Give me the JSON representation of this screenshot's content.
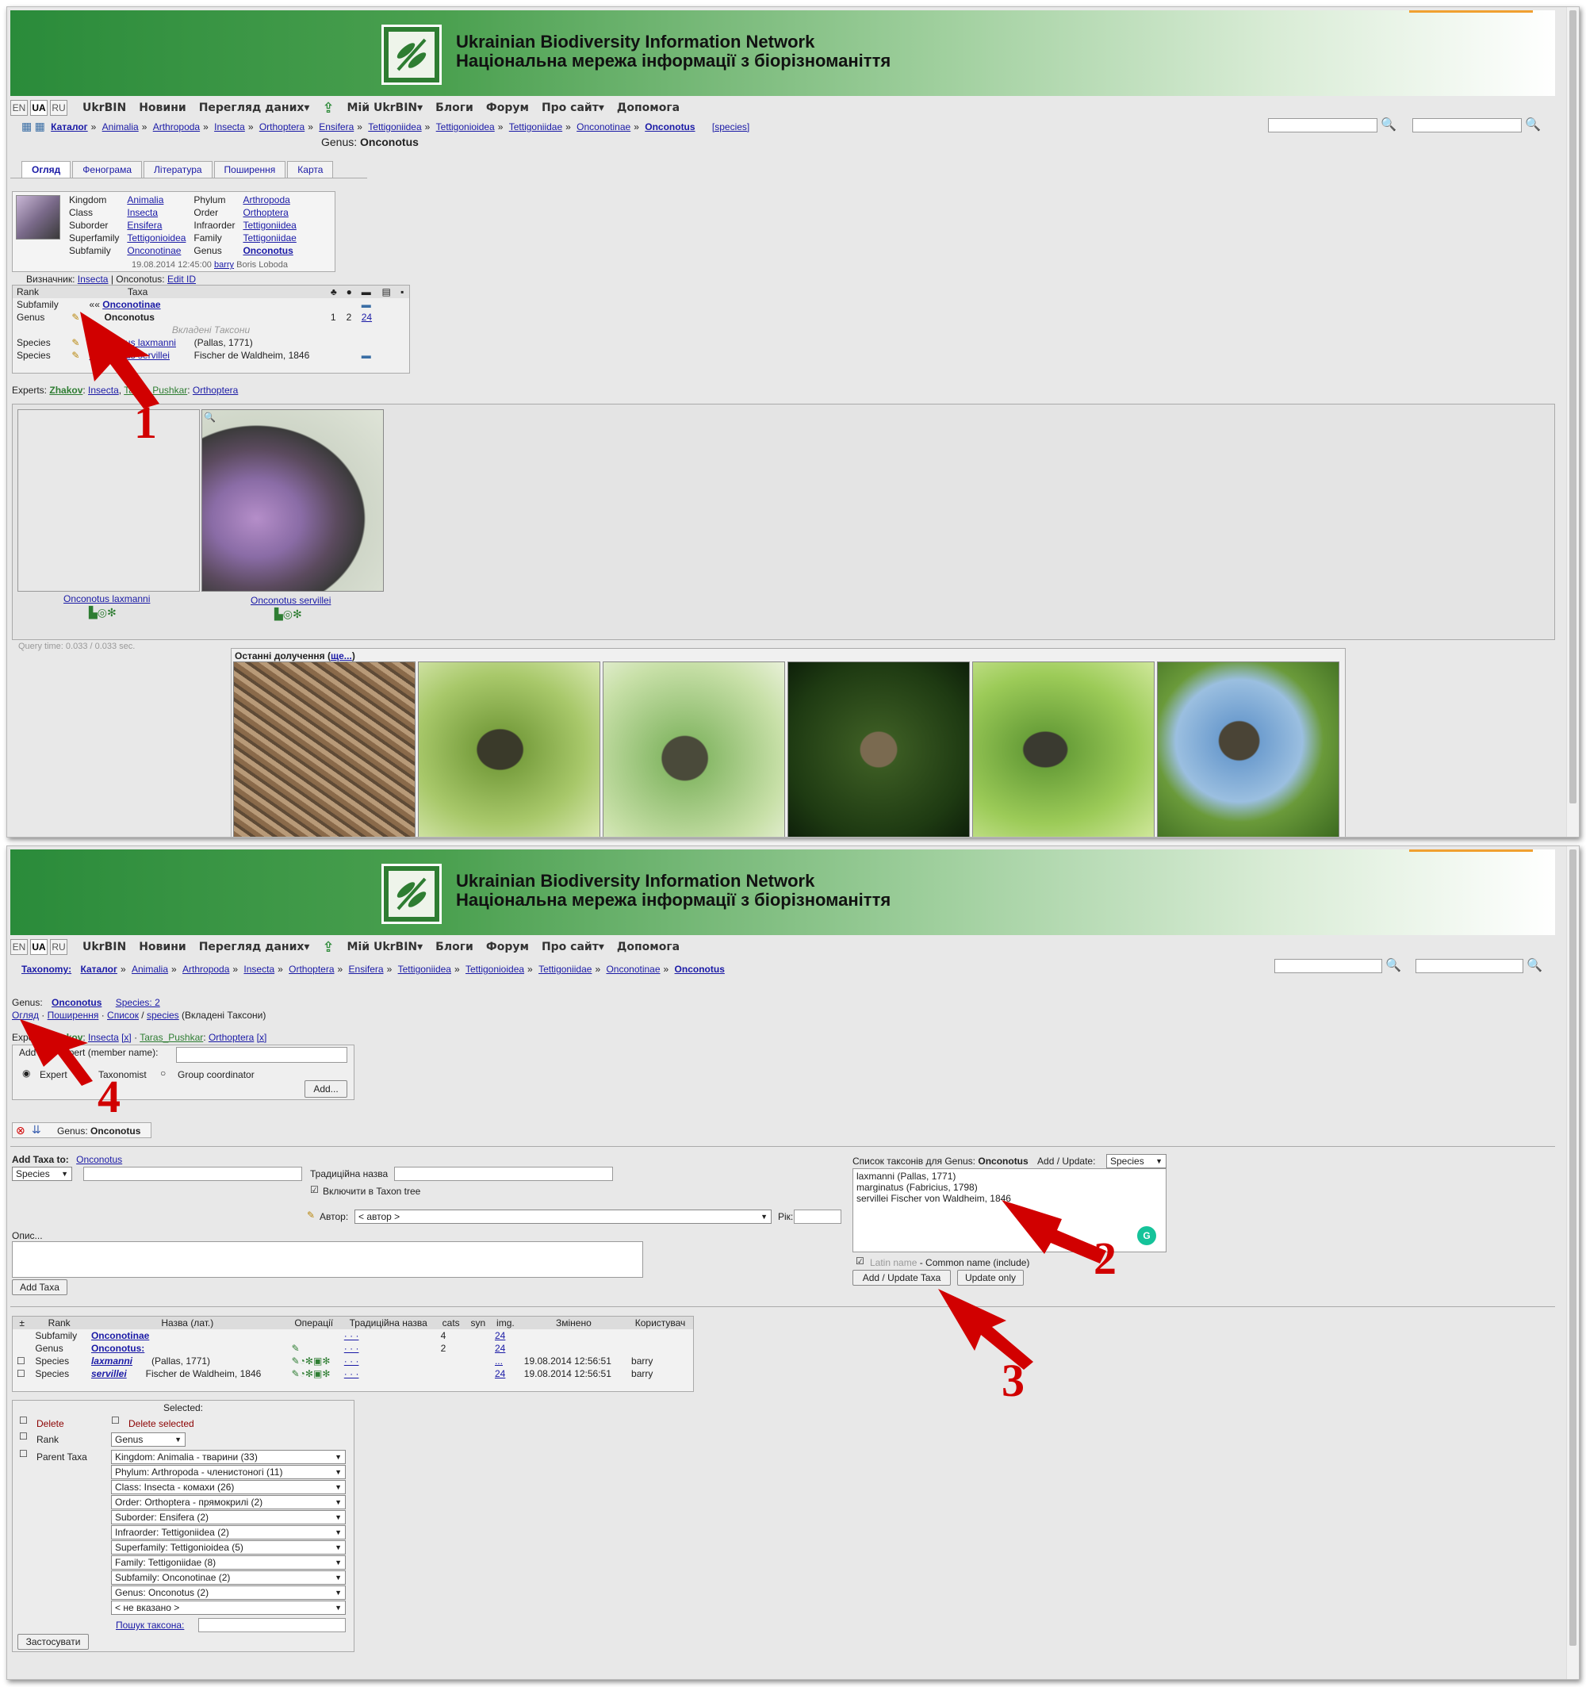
{
  "header": {
    "line1": "Ukrainian Biodiversity Information Network",
    "line2": "Національна мережа інформації з біорізноманіття"
  },
  "nav": {
    "langs": [
      "EN",
      "UA",
      "RU"
    ],
    "items": [
      "UkrBIN",
      "Новини",
      "Перегляд даних▾",
      "Мій UkrBIN▾",
      "Блоги",
      "Форум",
      "Про сайт▾",
      "Допомога"
    ]
  },
  "shot1": {
    "breadcrumb": [
      "Каталог",
      "Animalia",
      "Arthropoda",
      "Insecta",
      "Orthoptera",
      "Ensifera",
      "Tettigoniidea",
      "Tettigonioidea",
      "Tettigoniidae",
      "Onconotinae",
      "Onconotus"
    ],
    "breadcrumb_extra": "[species]",
    "genus_label": "Genus:",
    "genus_name": "Onconotus",
    "tabs": [
      "Огляд",
      "Фенограма",
      "Література",
      "Поширення",
      "Карта"
    ],
    "taxonomy": [
      [
        "Kingdom",
        "Animalia",
        "Phylum",
        "Arthropoda"
      ],
      [
        "Class",
        "Insecta",
        "Order",
        "Orthoptera"
      ],
      [
        "Suborder",
        "Ensifera",
        "Infraorder",
        "Tettigoniidea"
      ],
      [
        "Superfamily",
        "Tettigonioidea",
        "Family",
        "Tettigoniidae"
      ],
      [
        "Subfamily",
        "Onconotinae",
        "Genus",
        "Onconotus"
      ]
    ],
    "edited": "19.08.2014 12:45:00",
    "edited_user": "barry",
    "edited_name": "Boris Loboda",
    "identifier_label": "Визначник:",
    "identifier_link": "Insecta",
    "identifier_sep": "| Onconotus:",
    "identifier_edit": "Edit ID",
    "rank_table": {
      "head_rank": "Rank",
      "head_taxa": "Taxa",
      "rows": [
        {
          "rank": "Subfamily",
          "prefix": "«« ",
          "taxon": "Onconotinae",
          "author": "",
          "n1": "",
          "n2": "",
          "n3": ""
        },
        {
          "rank": "Genus",
          "prefix": "",
          "taxon": "Onconotus",
          "author": "",
          "n1": "1",
          "n2": "2",
          "n3": "24"
        }
      ],
      "nested_label": "Вкладені Таксони",
      "species": [
        {
          "rank": "Species",
          "taxon": "Onconotus laxmanni",
          "author": "(Pallas, 1771)"
        },
        {
          "rank": "Species",
          "taxon": "Onconotus servillei",
          "author": "Fischer de Waldheim, 1846"
        }
      ]
    },
    "experts_label": "Experts:",
    "experts": [
      {
        "name": "Zhakov",
        "group": "Insecta"
      },
      {
        "name": "Taras_Pushkar",
        "group": "Orthoptera"
      }
    ],
    "gallery_captions": [
      "Onconotus laxmanni",
      "Onconotus servillei"
    ],
    "query_time": "Query time: 0.033 / 0.033 sec.",
    "recent_label": "Останні долучення",
    "recent_more": "ще...",
    "arrow": "1"
  },
  "shot2": {
    "breadcrumb_label": "Taxonomy:",
    "breadcrumb": [
      "Каталог",
      "Animalia",
      "Arthropoda",
      "Insecta",
      "Orthoptera",
      "Ensifera",
      "Tettigoniidea",
      "Tettigonioidea",
      "Tettigoniidae",
      "Onconotinae",
      "Onconotus"
    ],
    "genus_label": "Genus:",
    "genus_name": "Onconotus",
    "species_count": "Species: 2",
    "sublinks": [
      "Огляд",
      "Поширення",
      "Список",
      "species"
    ],
    "sublinks_tail": "(Вкладені Таксони)",
    "experts_line": {
      "prefix": "Experts: ",
      "e1": "Zhakov",
      "g1": "Insecta",
      "e2": "Taras_Pushkar",
      "g2": "Orthoptera",
      "x": "[x]"
    },
    "add_expert_label": "Add new expert (member name):",
    "roles": [
      "Expert",
      "Taxonomist",
      "Group coordinator"
    ],
    "add_button": "Add...",
    "genus_bar": "Genus:",
    "genus_bar_name": "Onconotus",
    "add_taxa_label": "Add Taxa to:",
    "add_taxa_link": "Onconotus",
    "rank_select": "Species",
    "trad_name_label": "Традиційна назва",
    "include_tree": "Включити в Taxon tree",
    "author_label": "Автор:",
    "author_select": "< автор >",
    "year_label": "Рік:",
    "desc_label": "Опис...",
    "add_taxa_button": "Add Taxa",
    "list_label": "Список таксонів для Genus:",
    "list_genus": "Onconotus",
    "add_update_label": "Add / Update:",
    "add_update_select": "Species",
    "list_text": [
      "laxmanni (Pallas, 1771)",
      "marginatus (Fabricius, 1798)",
      "servillei Fischer von Waldheim, 1846"
    ],
    "latin_note": "Latin name",
    "latin_note_tail": " - Common name (include)",
    "add_update_button": "Add / Update Taxa",
    "update_only_button": "Update only",
    "table": {
      "headers": [
        "±",
        "Rank",
        "Назва (лат.)",
        "Операції",
        "Традиційна назва",
        "cats",
        "syn",
        "img.",
        "Змінено",
        "Користувач"
      ],
      "rows": [
        {
          "rank": "Subfamily",
          "name": "Onconotinae",
          "author": "",
          "trad": "· · ·",
          "cats": "4",
          "syn": "",
          "img": "24",
          "changed": "",
          "user": ""
        },
        {
          "rank": "Genus",
          "name": "Onconotus:",
          "author": "",
          "trad": "· · ·",
          "cats": "2",
          "syn": "",
          "img": "24",
          "changed": "",
          "user": ""
        },
        {
          "rank": "Species",
          "name": "laxmanni",
          "author": "(Pallas, 1771)",
          "trad": "· · ·",
          "cats": "",
          "syn": "",
          "img": "...",
          "changed": "19.08.2014 12:56:51",
          "user": "barry"
        },
        {
          "rank": "Species",
          "name": "servillei",
          "author": "Fischer de Waldheim, 1846",
          "trad": "· · ·",
          "cats": "",
          "syn": "",
          "img": "24",
          "changed": "19.08.2014 12:56:51",
          "user": "barry"
        }
      ]
    },
    "selected_label": "Selected:",
    "delete_label": "Delete",
    "delete_selected": "Delete selected",
    "rank_label": "Rank",
    "rank_value": "Genus",
    "parent_label": "Parent Taxa",
    "parents": [
      "Kingdom: Animalia - тварини (33)",
      "Phylum: Arthropoda - членистоногі (11)",
      "Class: Insecta - комахи (26)",
      "Order: Orthoptera - прямокрилі (2)",
      "Suborder: Ensifera (2)",
      "Infraorder: Tettigoniidea (2)",
      "Superfamily: Tettigonioidea (5)",
      "Family: Tettigoniidae (8)",
      "Subfamily: Onconotinae (2)",
      "Genus: Onconotus (2)",
      "< не вказано >"
    ],
    "search_taxon": "Пошук таксона:",
    "apply_button": "Застосувати",
    "arrows": [
      "2",
      "3",
      "4"
    ]
  },
  "colors": {
    "banner_dark": "#2a8b3a",
    "link": "#1a1aa6",
    "arrow": "#d10000",
    "bg": "#e8e8e8"
  }
}
